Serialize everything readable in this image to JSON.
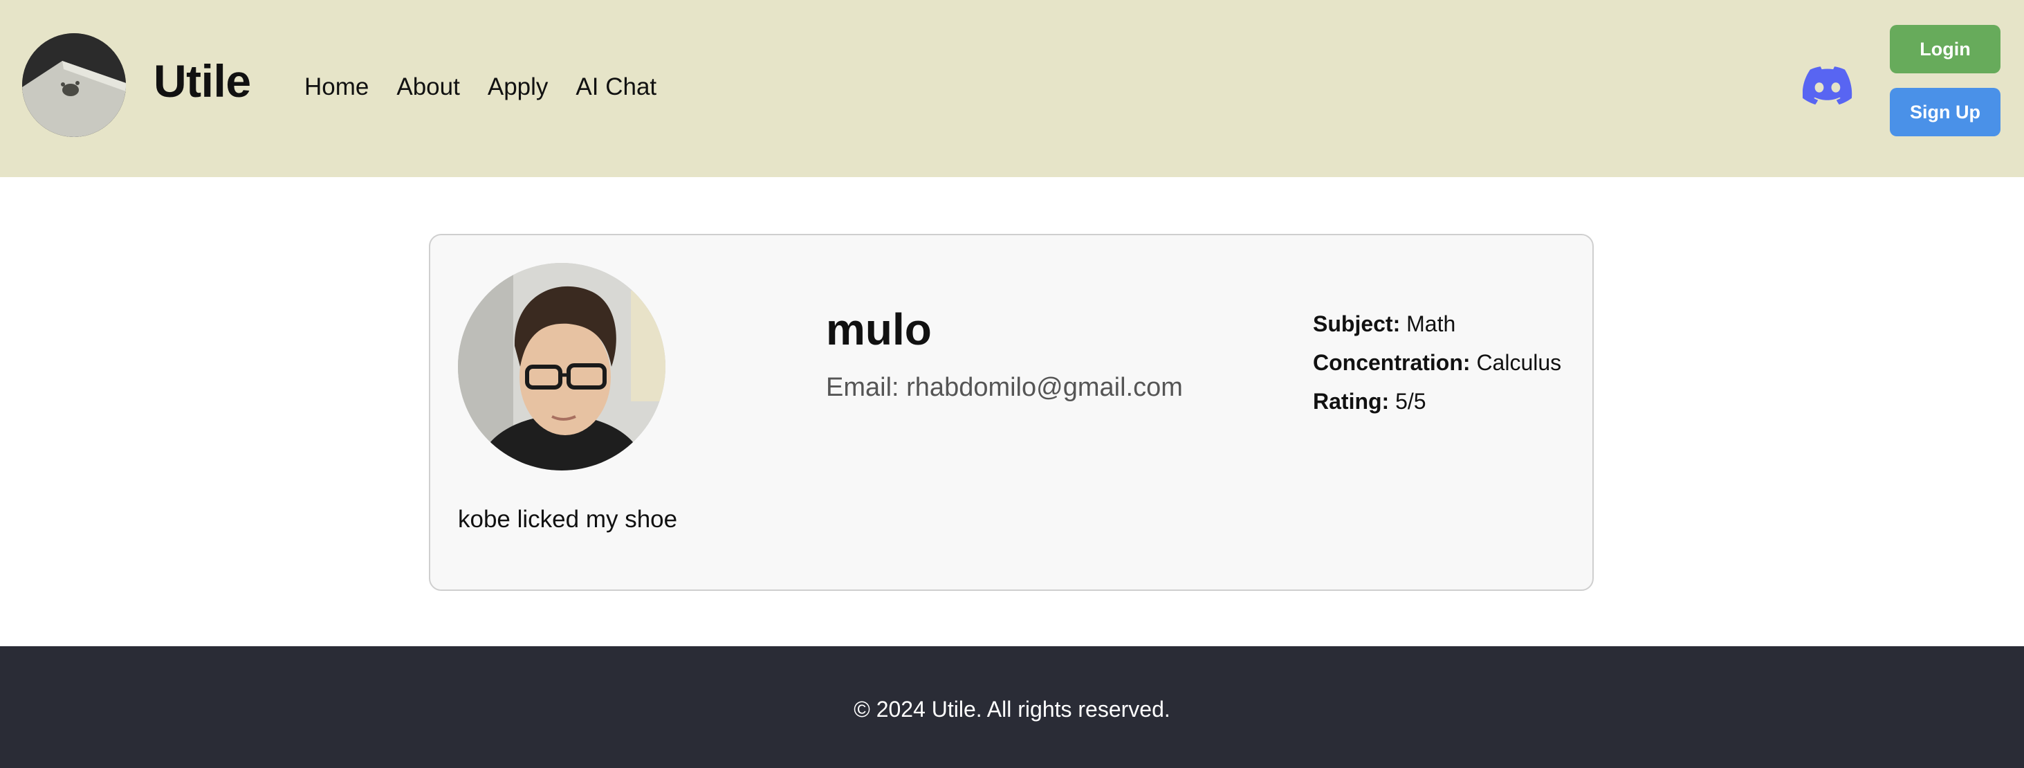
{
  "header": {
    "brand": "Utile",
    "nav": [
      "Home",
      "About",
      "Apply",
      "AI Chat"
    ],
    "login_label": "Login",
    "signup_label": "Sign Up",
    "icons": {
      "logo": "utile-logo-icon",
      "discord": "discord-icon"
    },
    "colors": {
      "background": "#e6e4c8",
      "login": "#67ab5b",
      "signup": "#4a91e8",
      "discord": "#5865f2"
    }
  },
  "profile": {
    "name": "mulo",
    "email_label": "Email: ",
    "email": "rhabdomilo@gmail.com",
    "bio": "kobe licked my shoe",
    "details": [
      {
        "key": "Subject:",
        "value": "Math"
      },
      {
        "key": "Concentration:",
        "value": "Calculus"
      },
      {
        "key": "Rating:",
        "value": "5/5"
      }
    ]
  },
  "footer": {
    "text": "© 2024 Utile. All rights reserved.",
    "background": "#2a2c36"
  }
}
